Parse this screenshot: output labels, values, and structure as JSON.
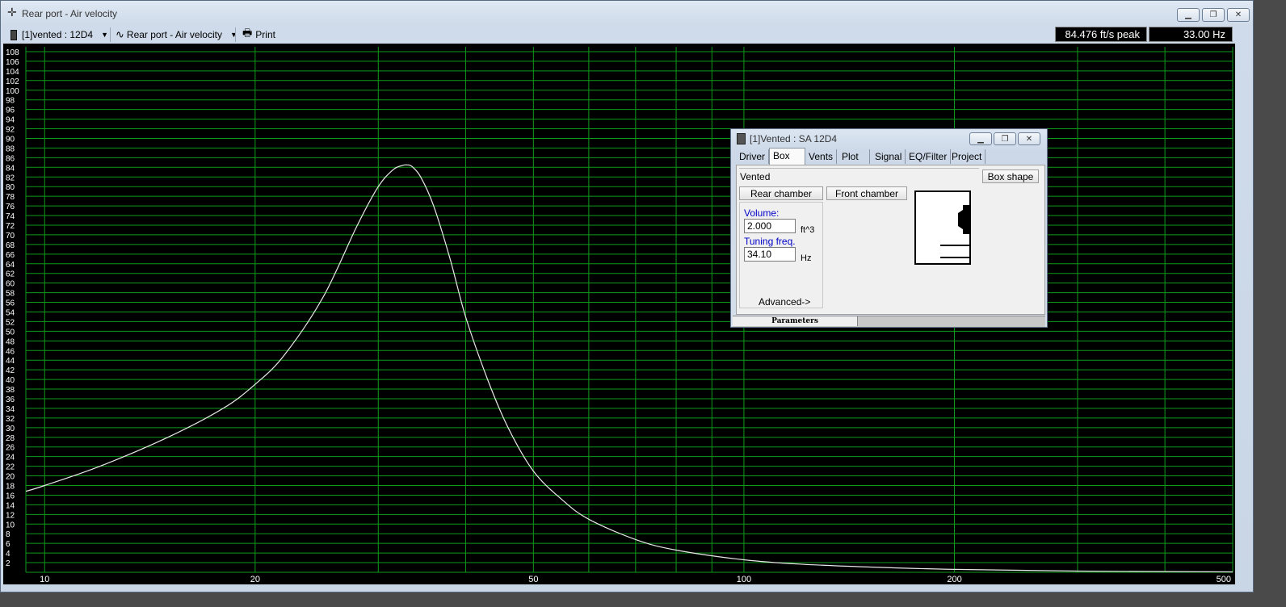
{
  "window": {
    "title": "Rear port - Air velocity"
  },
  "toolbar": {
    "project_select": "[1]vented : 12D4",
    "graph_select": "Rear port - Air velocity",
    "print_label": "Print",
    "peak_readout": "84.476 ft/s peak",
    "freq_readout": "33.00 Hz"
  },
  "chart_data": {
    "type": "line",
    "x_scale": "log",
    "xlim": [
      9.4,
      500
    ],
    "ylim": [
      0,
      109
    ],
    "x_tick_labels": [
      "10",
      "20",
      "50",
      "100",
      "200",
      "500"
    ],
    "y_tick_labels": [
      "2",
      "4",
      "6",
      "8",
      "10",
      "12",
      "14",
      "16",
      "18",
      "20",
      "22",
      "24",
      "26",
      "28",
      "30",
      "32",
      "34",
      "36",
      "38",
      "40",
      "42",
      "44",
      "46",
      "48",
      "50",
      "52",
      "54",
      "56",
      "58",
      "60",
      "62",
      "64",
      "66",
      "68",
      "70",
      "72",
      "74",
      "76",
      "78",
      "80",
      "82",
      "84",
      "86",
      "88",
      "90",
      "92",
      "94",
      "96",
      "98",
      "100",
      "102",
      "104",
      "106",
      "108"
    ],
    "series": [
      {
        "color": "#e8e8e8",
        "x": [
          9.4,
          10,
          12,
          15,
          18,
          20,
          22,
          25,
          28,
          30,
          31.5,
          32.5,
          33,
          33.5,
          34.5,
          36,
          38,
          40,
          43,
          46,
          50,
          55,
          60,
          70,
          80,
          100,
          120,
          150,
          200,
          300,
          500
        ],
        "y": [
          16.8,
          18,
          22,
          28,
          34,
          39,
          45,
          57,
          72,
          80,
          83.5,
          84.4,
          84.5,
          84.2,
          82,
          76,
          65,
          53,
          40,
          30,
          21,
          15,
          11,
          6.8,
          4.6,
          2.6,
          1.7,
          1.1,
          0.6,
          0.25,
          0.08
        ]
      }
    ],
    "grid": true,
    "grid_color": "#0e9a1a",
    "background": "#000000"
  },
  "dialog": {
    "title": "[1]Vented : SA 12D4",
    "tabs": [
      "Driver",
      "Box",
      "Vents",
      "Plot",
      "Signal",
      "EQ/Filter",
      "Project"
    ],
    "active_tab": "Box",
    "box_type": "Vented",
    "box_shape_label": "Box shape",
    "rear_chamber_label": "Rear chamber",
    "front_chamber_label": "Front chamber",
    "volume_label": "Volume:",
    "volume_value": "2.000",
    "volume_unit": "ft^3",
    "tuning_label": "Tuning freq.",
    "tuning_value": "34.10",
    "tuning_unit": "Hz",
    "advanced_label": "Advanced->",
    "status_label": "Parameters"
  }
}
